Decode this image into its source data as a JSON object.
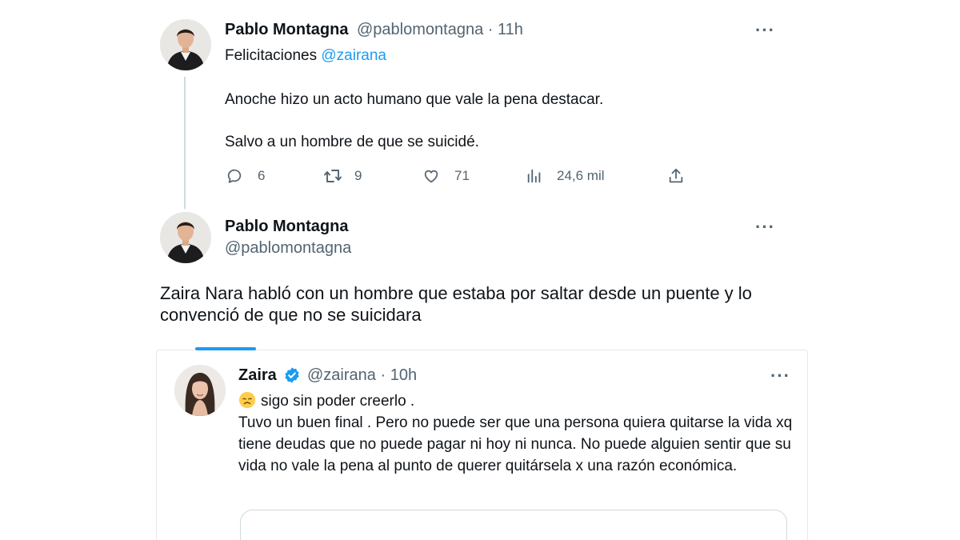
{
  "tweet1": {
    "name": "Pablo Montagna",
    "handle": "@pablomontagna",
    "separator": "·",
    "time": "11h",
    "line1_prefix": "Felicitaciones ",
    "line1_mention": "@zairana",
    "line2": "Anoche hizo un acto humano que vale la pena destacar.",
    "line3": "Salvo a un hombre de que se suicidé.",
    "replies": "6",
    "retweets": "9",
    "likes": "71",
    "views": "24,6 mil",
    "more": "···"
  },
  "tweet2": {
    "name": "Pablo Montagna",
    "handle": "@pablomontagna",
    "more": "···",
    "text": "Zaira Nara habló con un hombre que estaba por saltar desde un puente y lo convenció de que no se suicidara"
  },
  "quoted": {
    "name": "Zaira",
    "handle": "@zairana",
    "separator": "·",
    "time": "10h",
    "more": "···",
    "line1": "sigo sin poder creerlo .",
    "body": "Tuvo un buen final . Pero no puede ser que una persona quiera quitarse la vida xq tiene deudas que no puede pagar ni hoy ni nunca. No puede alguien sentir que su vida no vale la pena al punto de querer quitársela x una razón económica."
  },
  "colors": {
    "accent": "#1d9bf0",
    "text": "#0f1419",
    "secondary": "#536471"
  },
  "icons": {
    "reply": "reply-icon",
    "retweet": "retweet-icon",
    "like": "heart-icon",
    "views": "views-icon",
    "share": "share-icon",
    "verified": "verified-badge-icon",
    "emoji": "disappointed-face-emoji"
  }
}
